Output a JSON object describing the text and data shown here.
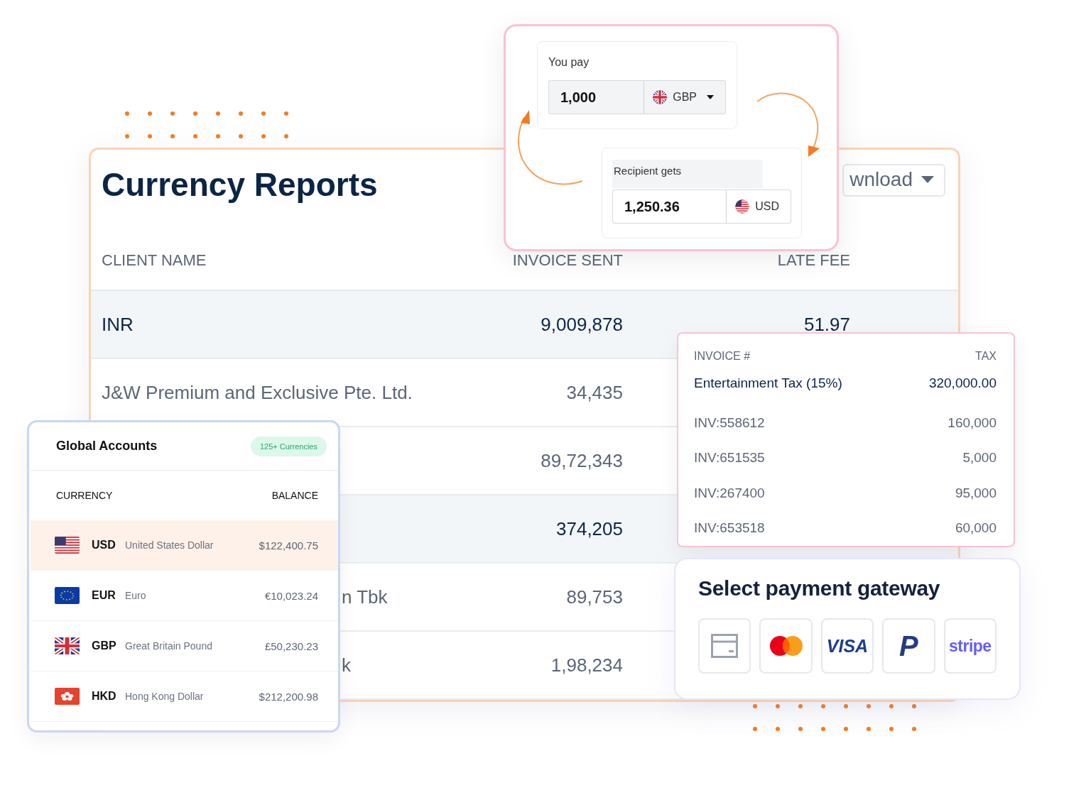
{
  "report": {
    "title": "Currency Reports",
    "download_button": "wnload",
    "columns": [
      "CLIENT NAME",
      "INVOICE SENT",
      "LATE FEE"
    ],
    "rows": [
      {
        "client": "INR",
        "invoice_sent": "9,009,878",
        "late_fee": "51.97",
        "highlighted": true,
        "clipped": false
      },
      {
        "client": "J&W Premium and Exclusive Pte. Ltd.",
        "invoice_sent": "34,435",
        "highlighted": false,
        "clipped": false
      },
      {
        "invoice_sent": "89,72,343",
        "highlighted": false
      },
      {
        "invoice_sent": "374,205",
        "highlighted": true
      },
      {
        "client": "n Tbk",
        "invoice_sent": "89,753",
        "highlighted": false,
        "clipped": true
      },
      {
        "client": "k",
        "invoice_sent": "1,98,234",
        "highlighted": false,
        "clipped": true
      }
    ]
  },
  "exchange": {
    "pay_label": "You pay",
    "pay_amount": "1,000",
    "pay_currency": {
      "code": "GBP",
      "kind": "gb"
    },
    "get_label": "Recipient gets",
    "get_amount": "1,250.36",
    "get_currency": {
      "code": "USD",
      "kind": "us"
    }
  },
  "invoices": {
    "columns": [
      "INVOICE #",
      "TAX"
    ],
    "rows": [
      {
        "kind": "summary",
        "label": "Entertainment Tax (15%)",
        "value": "320,000.00"
      },
      {
        "kind": "item",
        "label": "INV:558612",
        "value": "160,000"
      },
      {
        "kind": "item",
        "label": "INV:651535",
        "value": "5,000"
      },
      {
        "kind": "item",
        "label": "INV:267400",
        "value": "95,000"
      },
      {
        "kind": "item",
        "label": "INV:653518",
        "value": "60,000"
      }
    ]
  },
  "global_accounts": {
    "title": "Global Accounts",
    "badge": "125+ Currencies",
    "columns": [
      "CURRENCY",
      "BALANCE"
    ],
    "rows": [
      {
        "kind": "us",
        "code": "USD",
        "name": "United States Dollar",
        "balance": "$122,400.75",
        "selected": true
      },
      {
        "kind": "eu",
        "code": "EUR",
        "name": "Euro",
        "balance": "€10,023.24",
        "selected": false
      },
      {
        "kind": "gb",
        "code": "GBP",
        "name": "Great Britain Pound",
        "balance": "£50,230.23",
        "selected": false
      },
      {
        "kind": "hk",
        "code": "HKD",
        "name": "Hong Kong Dollar",
        "balance": "$212,200.98",
        "selected": false
      }
    ]
  },
  "payment": {
    "title": "Select payment gateway",
    "gateways": [
      {
        "kind": "card"
      },
      {
        "kind": "circles"
      },
      {
        "kind": "wordmark",
        "text": "VISA",
        "color": "#1a3d8f"
      },
      {
        "kind": "letter",
        "text": "P",
        "color": "#253b80"
      },
      {
        "kind": "wordmark",
        "text": "stripe",
        "color": "#635bff"
      }
    ]
  }
}
